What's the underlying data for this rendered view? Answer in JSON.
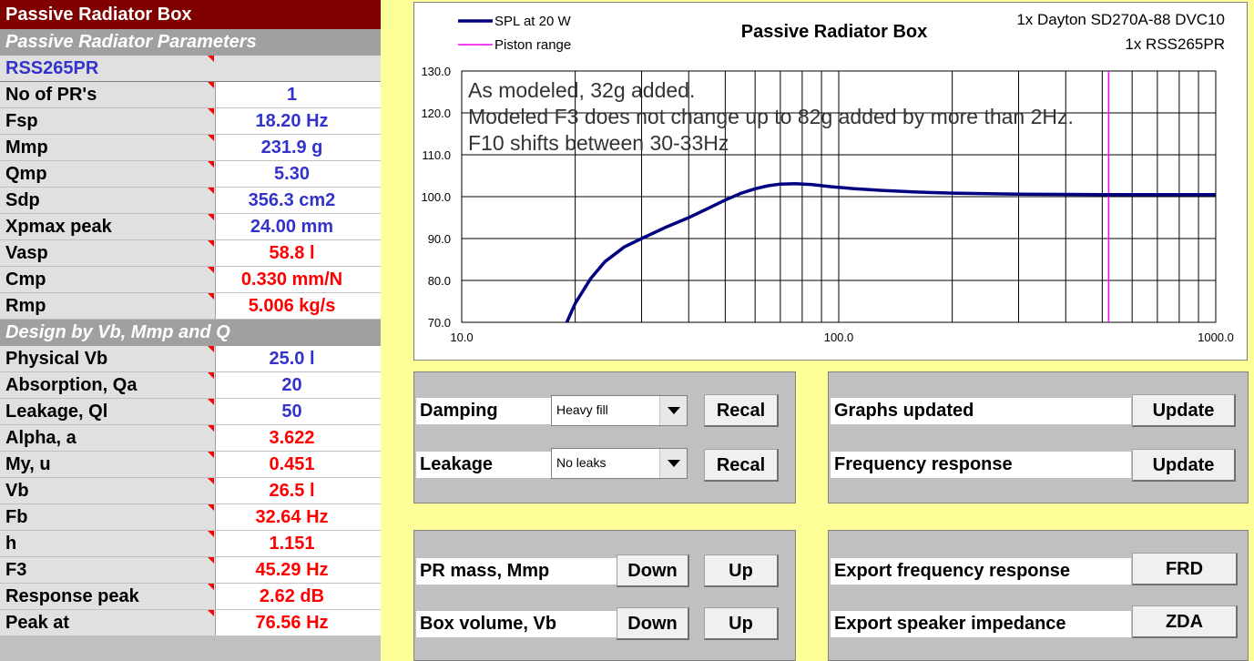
{
  "left": {
    "title": "Passive Radiator Box",
    "section1": "Passive Radiator Parameters",
    "pr_name": "RSS265PR",
    "params": [
      {
        "label": "No of PR's",
        "value": "1",
        "color": "blue"
      },
      {
        "label": "Fsp",
        "value": "18.20 Hz",
        "color": "blue"
      },
      {
        "label": "Mmp",
        "value": "231.9 g",
        "color": "blue"
      },
      {
        "label": "Qmp",
        "value": "5.30",
        "color": "blue"
      },
      {
        "label": "Sdp",
        "value": "356.3 cm2",
        "color": "blue"
      },
      {
        "label": "Xpmax peak",
        "value": "24.00 mm",
        "color": "blue"
      },
      {
        "label": "Vasp",
        "value": "58.8 l",
        "color": "red"
      },
      {
        "label": "Cmp",
        "value": "0.330 mm/N",
        "color": "red"
      },
      {
        "label": "Rmp",
        "value": "5.006 kg/s",
        "color": "red"
      }
    ],
    "section2": "Design by Vb, Mmp and Q",
    "design": [
      {
        "label": "Physical Vb",
        "value": "25.0 l",
        "color": "blue"
      },
      {
        "label": "Absorption, Qa",
        "value": "20",
        "color": "blue"
      },
      {
        "label": "Leakage, Ql",
        "value": "50",
        "color": "blue"
      },
      {
        "label": "Alpha, a",
        "value": "3.622",
        "color": "red"
      },
      {
        "label": "My, u",
        "value": "0.451",
        "color": "red"
      },
      {
        "label": "Vb",
        "value": "26.5 l",
        "color": "red"
      },
      {
        "label": "Fb",
        "value": "32.64 Hz",
        "color": "red"
      },
      {
        "label": "h",
        "value": "1.151",
        "color": "red"
      },
      {
        "label": "F3",
        "value": "45.29 Hz",
        "color": "red"
      },
      {
        "label": "Response peak",
        "value": "2.62 dB",
        "color": "red"
      },
      {
        "label": "Peak at",
        "value": "76.56 Hz",
        "color": "red"
      }
    ]
  },
  "chart_data": {
    "type": "line",
    "title": "Passive Radiator Box",
    "legend": [
      "SPL at 20 W",
      "Piston range"
    ],
    "info": [
      "1x Dayton SD270A-88 DVC10",
      "1x RSS265PR"
    ],
    "annotation": [
      "As modeled, 32g added.",
      "Modeled F3 does not change up to 82g added by more than 2Hz.",
      "F10 shifts between 30-33Hz"
    ],
    "x_scale": "log",
    "xlim": [
      10,
      1000
    ],
    "ylim": [
      70,
      130
    ],
    "x_ticks": [
      "10.0",
      "100.0",
      "1000.0"
    ],
    "y_ticks": [
      "130.0",
      "120.0",
      "110.0",
      "100.0",
      "90.0",
      "80.0",
      "70.0"
    ],
    "series": [
      {
        "name": "SPL at 20 W",
        "color": "#000080",
        "x": [
          19.0,
          20,
          22,
          24,
          27,
          30,
          35,
          40,
          45,
          50,
          55,
          60,
          65,
          70,
          76.5,
          85,
          95,
          110,
          130,
          160,
          200,
          250,
          300,
          400,
          500,
          600,
          800,
          1000
        ],
        "y": [
          70.0,
          74.5,
          80.5,
          84.5,
          88.0,
          90.0,
          92.8,
          95.0,
          97.2,
          99.2,
          100.8,
          101.9,
          102.6,
          103.0,
          103.1,
          102.9,
          102.4,
          101.9,
          101.5,
          101.1,
          100.85,
          100.7,
          100.6,
          100.55,
          100.5,
          100.5,
          100.5,
          100.5
        ]
      },
      {
        "name": "Piston range",
        "color": "#FF00FF",
        "x_vertical": 520
      }
    ],
    "grid": true
  },
  "panels": {
    "damping_label": "Damping",
    "damping_value": "Heavy fill",
    "leakage_label": "Leakage",
    "leakage_value": "No leaks",
    "recal": "Recal",
    "graphs_updated": "Graphs updated",
    "frequency_response": "Frequency response",
    "update": "Update",
    "pr_mass": "PR mass, Mmp",
    "box_volume": "Box volume, Vb",
    "down": "Down",
    "up": "Up",
    "export_fr": "Export frequency response",
    "export_imp": "Export speaker impedance",
    "frd": "FRD",
    "zda": "ZDA"
  }
}
